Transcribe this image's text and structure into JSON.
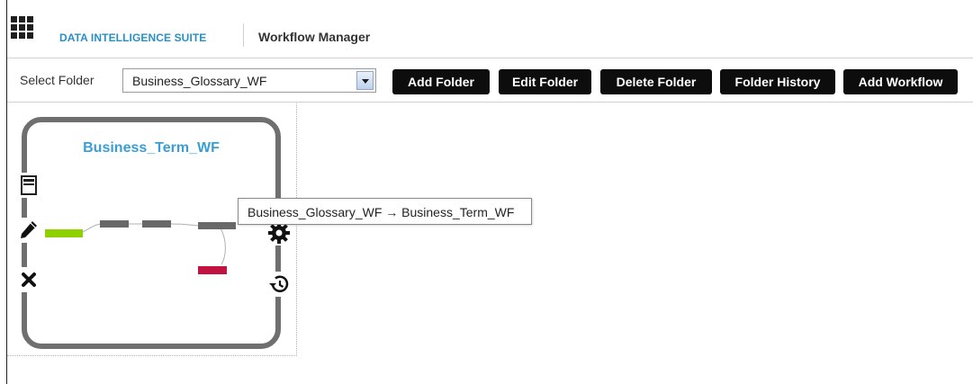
{
  "header": {
    "suite_name": "DATA INTELLIGENCE SUITE",
    "app_name": "Workflow Manager"
  },
  "toolbar": {
    "folder_label": "Select Folder",
    "folder_value": "Business_Glossary_WF",
    "buttons": {
      "add_folder": "Add Folder",
      "edit_folder": "Edit Folder",
      "delete_folder": "Delete Folder",
      "folder_history": "Folder History",
      "add_workflow": "Add Workflow"
    }
  },
  "workflow_card": {
    "title": "Business_Term_WF",
    "tooltip": "Business_Glossary_WF → Business_Term_WF",
    "icons": [
      "view-icon",
      "edit-icon",
      "delete-icon",
      "settings-gear-icon",
      "history-icon"
    ]
  },
  "colors": {
    "accent": "#2a8fc4",
    "card_border": "#6f6f6f",
    "start_node": "#8fd000",
    "mid_node": "#686868",
    "end_node": "#c2123f"
  }
}
